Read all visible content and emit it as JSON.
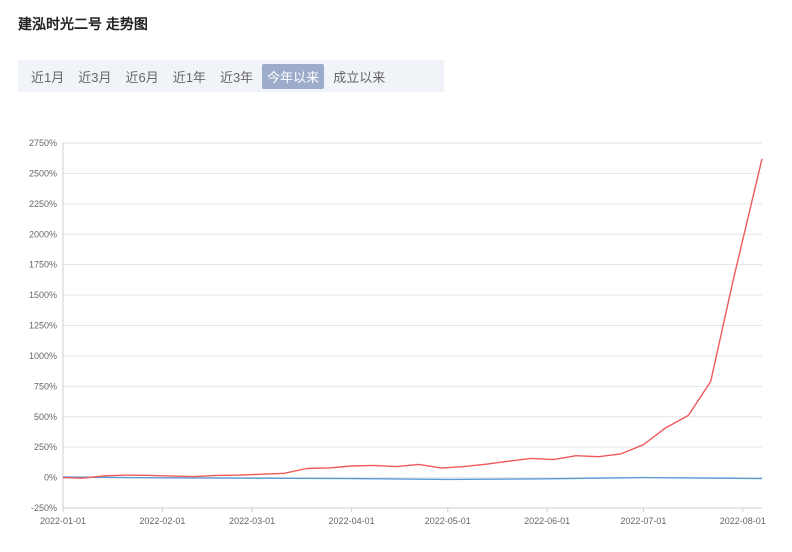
{
  "header": {
    "title": "建泓时光二号 走势图"
  },
  "range_tabs": [
    {
      "label": "近1月",
      "active": false
    },
    {
      "label": "近3月",
      "active": false
    },
    {
      "label": "近6月",
      "active": false
    },
    {
      "label": "近1年",
      "active": false
    },
    {
      "label": "近3年",
      "active": false
    },
    {
      "label": "今年以来",
      "active": true
    },
    {
      "label": "成立以来",
      "active": false
    }
  ],
  "chart_data": {
    "type": "line",
    "y_ticks": [
      "2750%",
      "2500%",
      "2250%",
      "2000%",
      "1750%",
      "1500%",
      "1250%",
      "1000%",
      "750%",
      "500%",
      "250%",
      "0%",
      "-250%"
    ],
    "ylim": [
      -250,
      2750
    ],
    "x_ticks": [
      "2022-01-01",
      "2022-02-01",
      "2022-03-01",
      "2022-04-01",
      "2022-05-01",
      "2022-06-01",
      "2022-07-01",
      "2022-08-01"
    ],
    "xlim": [
      "2022-01-01",
      "2022-08-07"
    ],
    "grid": true,
    "colors": {
      "series1": "#ee5a5a",
      "series2": "#5b9bd5",
      "grid": "#e6e6e6",
      "axis": "#cccccc"
    },
    "series": [
      {
        "x": [
          "2022-01-01",
          "2022-01-07",
          "2022-01-14",
          "2022-01-21",
          "2022-01-28",
          "2022-02-04",
          "2022-02-11",
          "2022-02-18",
          "2022-02-25",
          "2022-03-04",
          "2022-03-11",
          "2022-03-18",
          "2022-03-25",
          "2022-04-01",
          "2022-04-08",
          "2022-04-15",
          "2022-04-22",
          "2022-04-29",
          "2022-05-06",
          "2022-05-13",
          "2022-05-20",
          "2022-05-27",
          "2022-06-03",
          "2022-06-10",
          "2022-06-17",
          "2022-06-24",
          "2022-07-01",
          "2022-07-08",
          "2022-07-15",
          "2022-07-22",
          "2022-07-29",
          "2022-08-07"
        ],
        "values": [
          0,
          -5,
          15,
          20,
          18,
          12,
          8,
          18,
          20,
          28,
          35,
          75,
          80,
          95,
          100,
          90,
          108,
          78,
          90,
          110,
          135,
          158,
          148,
          180,
          172,
          195,
          270,
          410,
          510,
          790,
          1620,
          2620
        ]
      },
      {
        "x": [
          "2022-01-01",
          "2022-02-01",
          "2022-03-01",
          "2022-04-01",
          "2022-05-01",
          "2022-06-01",
          "2022-07-01",
          "2022-08-07"
        ],
        "values": [
          5,
          -2,
          -5,
          -8,
          -15,
          -10,
          0,
          -8
        ]
      }
    ]
  }
}
